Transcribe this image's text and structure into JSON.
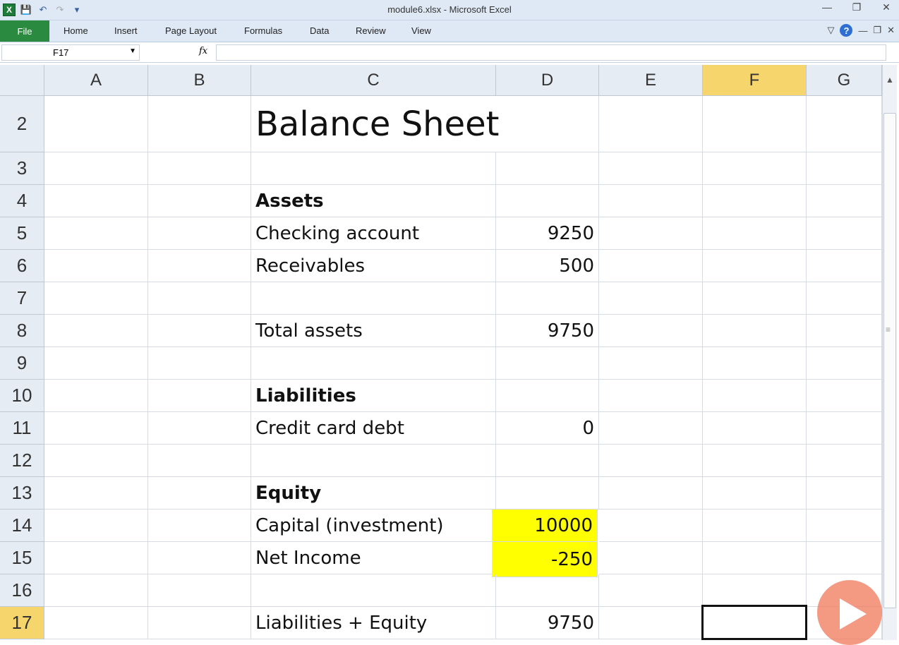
{
  "window": {
    "title": "module6.xlsx - Microsoft Excel",
    "app_icon": "X"
  },
  "ribbon": {
    "file_label": "File",
    "tabs": [
      "Home",
      "Insert",
      "Page Layout",
      "Formulas",
      "Data",
      "Review",
      "View"
    ]
  },
  "formula_bar": {
    "name_box": "F17",
    "fx_label": "fx",
    "formula": ""
  },
  "sheet": {
    "columns": [
      "A",
      "B",
      "C",
      "D",
      "E",
      "F",
      "G"
    ],
    "selected_column": "F",
    "selected_row": "17",
    "active_cell": "F17",
    "highlight_color": "#ffff00",
    "rows": [
      {
        "num": "2",
        "c": "Balance Sheet",
        "d": ""
      },
      {
        "num": "3",
        "c": "",
        "d": ""
      },
      {
        "num": "4",
        "c": "Assets",
        "d": ""
      },
      {
        "num": "5",
        "c": "Checking account",
        "d": "9250"
      },
      {
        "num": "6",
        "c": "Receivables",
        "d": "500"
      },
      {
        "num": "7",
        "c": "",
        "d": ""
      },
      {
        "num": "8",
        "c": "Total assets",
        "d": "9750"
      },
      {
        "num": "9",
        "c": "",
        "d": ""
      },
      {
        "num": "10",
        "c": "Liabilities",
        "d": ""
      },
      {
        "num": "11",
        "c": "Credit card debt",
        "d": "0"
      },
      {
        "num": "12",
        "c": "",
        "d": ""
      },
      {
        "num": "13",
        "c": "Equity",
        "d": ""
      },
      {
        "num": "14",
        "c": "Capital (investment)",
        "d": "10000"
      },
      {
        "num": "15",
        "c": "Net Income",
        "d": "-250"
      },
      {
        "num": "16",
        "c": "",
        "d": ""
      },
      {
        "num": "17",
        "c": "Liabilities + Equity",
        "d": "9750"
      }
    ]
  }
}
